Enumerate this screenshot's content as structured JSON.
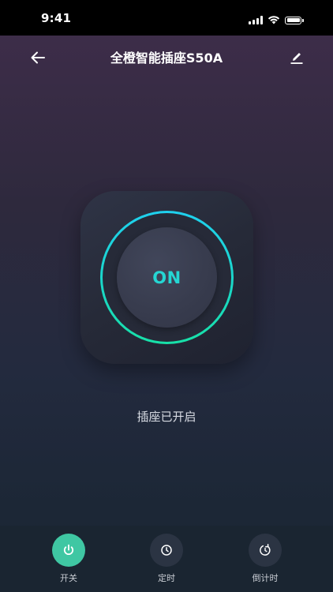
{
  "status_bar": {
    "time": "9:41"
  },
  "header": {
    "title": "全橙智能插座S50A"
  },
  "power": {
    "label": "ON",
    "status": "插座已开启"
  },
  "tabbar": {
    "items": [
      {
        "label": "开关",
        "icon": "power-icon",
        "active": true
      },
      {
        "label": "定时",
        "icon": "timer-icon",
        "active": false
      },
      {
        "label": "倒计时",
        "icon": "countdown-icon",
        "active": false
      }
    ]
  },
  "colors": {
    "accent_ring": "#1fd0ee",
    "on_label": "#25d6d3",
    "active_tab": "#3fc7a3"
  }
}
